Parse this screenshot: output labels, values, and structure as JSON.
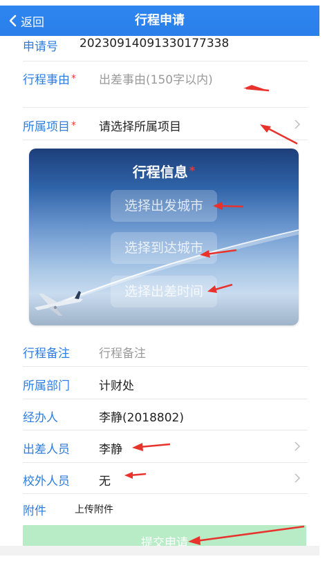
{
  "header": {
    "back_label": "返回",
    "title": "行程申请"
  },
  "form": {
    "application_no": {
      "label": "申请号",
      "value": "20230914091330177338"
    },
    "trip_reason": {
      "label": "行程事由",
      "placeholder": "出差事由(150字以内)"
    },
    "project": {
      "label": "所属项目",
      "placeholder": "请选择所属项目"
    },
    "required_mark": "*",
    "itinerary": {
      "title": "行程信息",
      "departure": "选择出发城市",
      "arrival": "选择到达城市",
      "time": "选择出差时间"
    },
    "remark": {
      "label": "行程备注",
      "placeholder": "行程备注"
    },
    "department": {
      "label": "所属部门",
      "value": "计财处"
    },
    "handler": {
      "label": "经办人",
      "value": "李静(2018802)"
    },
    "travelers": {
      "label": "出差人员",
      "value": "李静"
    },
    "external": {
      "label": "校外人员",
      "value": "无"
    },
    "attachment": {
      "label": "附件",
      "action": "上传附件"
    }
  },
  "submit_label": "提交申请",
  "colors": {
    "header": "#2a7fe9",
    "label": "#2d7de0",
    "required": "#e23b3b",
    "submit": "#b7ecc7",
    "annotation": "#e8322c"
  }
}
